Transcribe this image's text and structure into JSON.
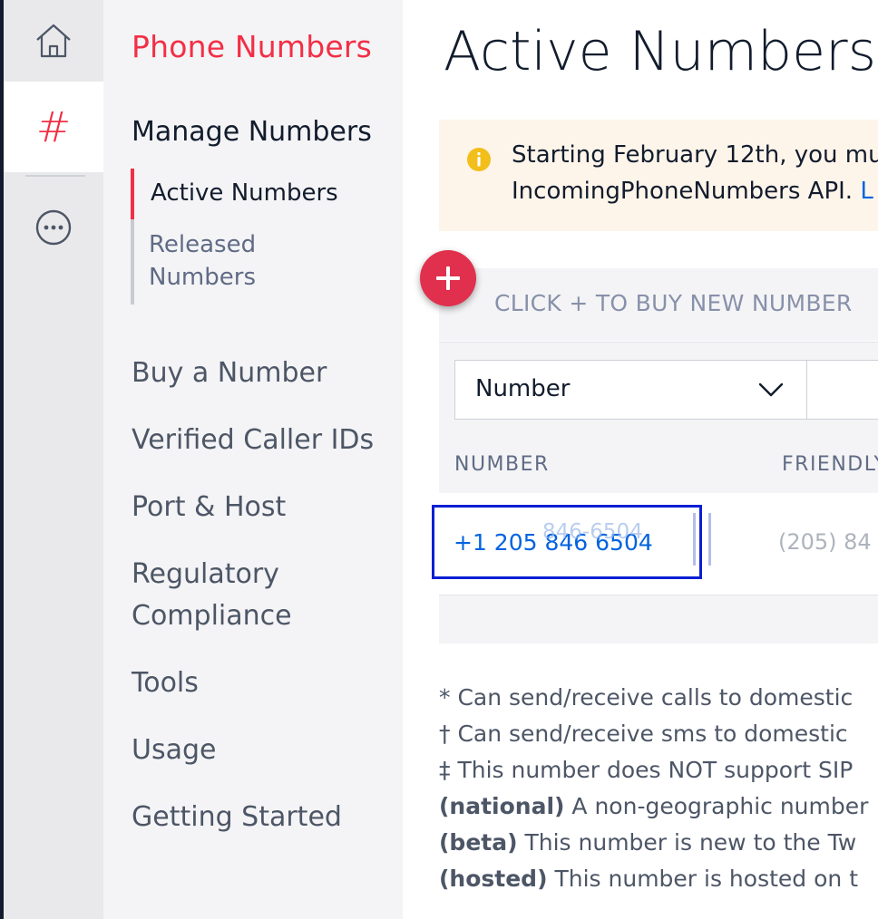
{
  "rail": {
    "items": [
      "home-icon",
      "hash-icon",
      "more-icon"
    ],
    "hash_glyph": "#"
  },
  "nav": {
    "title": "Phone Numbers",
    "section": "Manage Numbers",
    "sub_items": [
      {
        "label": "Active Numbers",
        "active": true
      },
      {
        "label": "Released Numbers",
        "active": false
      }
    ],
    "links": [
      "Buy a Number",
      "Verified Caller IDs",
      "Port & Host",
      "Regulatory Compliance",
      "Tools",
      "Usage",
      "Getting Started"
    ]
  },
  "main": {
    "title": "Active Numbers",
    "notice": {
      "line1": "Starting February 12th, you mu",
      "line2": "IncomingPhoneNumbers API.",
      "link": "L"
    },
    "buy_bar": {
      "add_symbol": "+",
      "text": "CLICK + TO BUY NEW NUMBER"
    },
    "filter": {
      "selected": "Number",
      "options": [
        "Number"
      ]
    },
    "table": {
      "columns": [
        "NUMBER",
        "FRIENDLY"
      ],
      "rows": [
        {
          "number": "+1 205 846 6504",
          "number_ghost": "846-6504",
          "friendly": "(205) 84"
        }
      ]
    },
    "footnotes": [
      {
        "mark": "*",
        "bold": "",
        "text": "Can send/receive calls to domestic"
      },
      {
        "mark": "†",
        "bold": "",
        "text": "Can send/receive sms to domestic"
      },
      {
        "mark": "‡",
        "bold": "",
        "text": "This number does NOT support SIP"
      },
      {
        "mark": "",
        "bold": "(national)",
        "text": "A non-geographic number"
      },
      {
        "mark": "",
        "bold": "(beta)",
        "text": "This number is new to the Tw"
      },
      {
        "mark": "",
        "bold": "(hosted)",
        "text": "This number is hosted on t"
      }
    ]
  },
  "colors": {
    "brand_red": "#f22f46",
    "link_blue": "#0263e0",
    "notice_bg": "#fef5ea",
    "notice_icon": "#f2be1a"
  }
}
